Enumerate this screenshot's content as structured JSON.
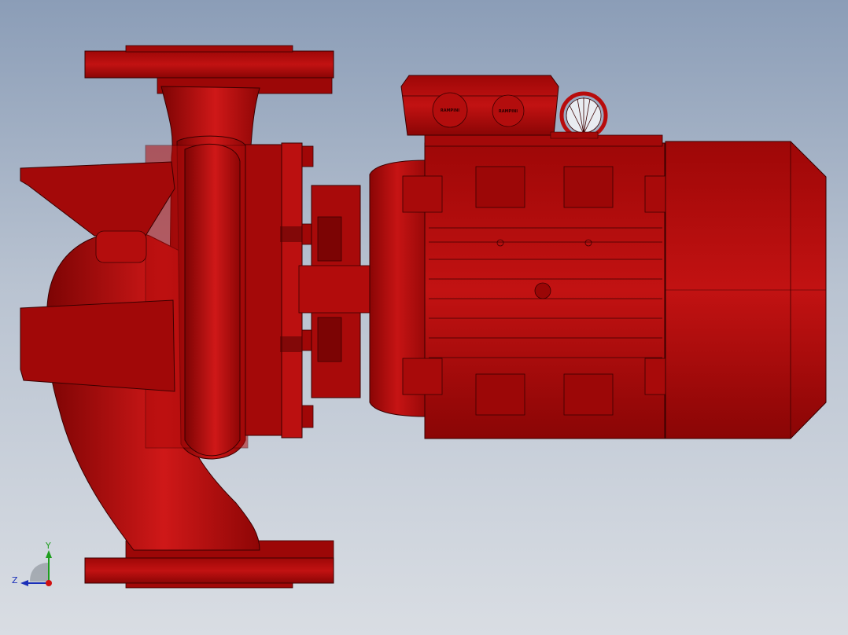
{
  "viewport": {
    "background_top": "#8b9db7",
    "background_bottom": "#d9dde3"
  },
  "model": {
    "body_color": "#b80c0c",
    "edge_color": "#3a0000",
    "components": [
      "inlet-outlet-flanges",
      "volute-casing",
      "pump-bracket",
      "motor-terminal-box",
      "motor-housing",
      "motor-fan-cover"
    ]
  },
  "terminal_box": {
    "badge_left_text": "RAMPINI",
    "badge_right_text": "RAMPINI"
  },
  "axis_triad": {
    "y_label": "Y",
    "z_label": "Z",
    "y_color": "#1e9e1e",
    "z_color": "#1a2fb8",
    "x_color": "#d01010"
  }
}
